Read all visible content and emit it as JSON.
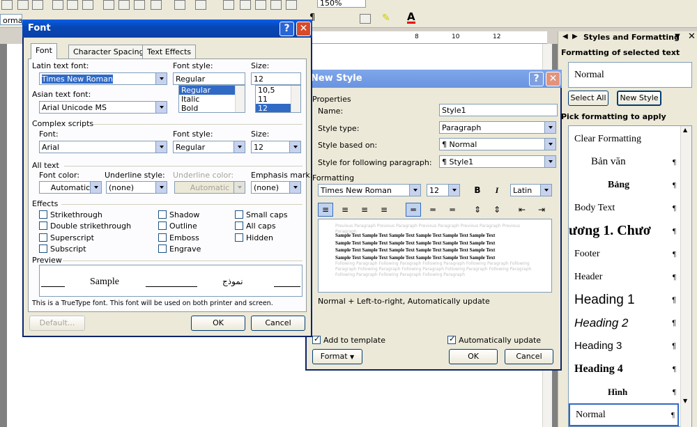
{
  "toolbar": {
    "zoom": "150%",
    "style_box": "ormal"
  },
  "ruler": {
    "ticks": [
      "8",
      "10",
      "12"
    ]
  },
  "font_dialog": {
    "title": "Font",
    "tabs": [
      "Font",
      "Character Spacing",
      "Text Effects"
    ],
    "latin": {
      "font_label": "Latin text font:",
      "font": "Times New Roman",
      "style_label": "Font style:",
      "style": "Regular",
      "size_label": "Size:",
      "size": "12",
      "style_options": [
        "Regular",
        "Italic",
        "Bold"
      ],
      "size_options": [
        "10,5",
        "11",
        "12"
      ]
    },
    "asian": {
      "font_label": "Asian text font:",
      "font": "Arial Unicode MS"
    },
    "complex": {
      "section": "Complex scripts",
      "font_label": "Font:",
      "font": "Arial",
      "style_label": "Font style:",
      "style": "Regular",
      "size_label": "Size:",
      "size": "12"
    },
    "alltext": {
      "section": "All text",
      "color_label": "Font color:",
      "color": "Automatic",
      "underline_label": "Underline style:",
      "underline": "(none)",
      "ucolor_label": "Underline color:",
      "ucolor": "Automatic",
      "emphasis_label": "Emphasis mark:",
      "emphasis": "(none)"
    },
    "effects": {
      "section": "Effects",
      "col1": [
        "Strikethrough",
        "Double strikethrough",
        "Superscript",
        "Subscript"
      ],
      "col2": [
        "Shadow",
        "Outline",
        "Emboss",
        "Engrave"
      ],
      "col3": [
        "Small caps",
        "All caps",
        "Hidden"
      ]
    },
    "preview": {
      "section": "Preview",
      "sample": "Sample",
      "arabic": "نموذج",
      "note": "This is a TrueType font. This font will be used on both printer and screen."
    },
    "buttons": {
      "default": "Default...",
      "ok": "OK",
      "cancel": "Cancel"
    }
  },
  "new_style": {
    "title": "New Style",
    "properties": "Properties",
    "name_label": "Name:",
    "name": "Style1",
    "type_label": "Style type:",
    "type": "Paragraph",
    "based_label": "Style based on:",
    "based": "¶ Normal",
    "following_label": "Style for following paragraph:",
    "following": "¶ Style1",
    "formatting": "Formatting",
    "font": "Times New Roman",
    "size": "12",
    "script": "Latin",
    "sample_text": "Sample Text Sample Text Sample Text Sample Text Sample Text Sample Text",
    "description": "Normal + Left-to-right, Automatically update",
    "add_template": "Add to template",
    "auto_update": "Automatically update",
    "format_btn": "Format",
    "ok": "OK",
    "cancel": "Cancel"
  },
  "taskpane": {
    "title": "Styles and Formatting",
    "selected_label": "Formatting of selected text",
    "selected": "Normal",
    "select_all": "Select All",
    "new_style": "New Style",
    "pick_label": "Pick formatting to apply",
    "styles": [
      "Clear Formatting",
      "Bản văn",
      "Bảng",
      "Body Text",
      "ương 1.  Chươ",
      "Footer",
      "Header",
      "Heading 1",
      "Heading 2",
      "Heading 3",
      "Heading 4",
      "Hình",
      "Normal"
    ]
  }
}
